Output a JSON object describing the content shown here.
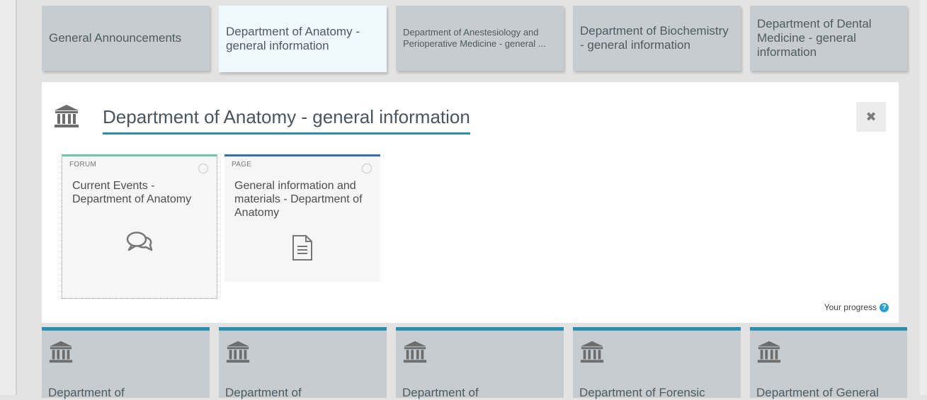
{
  "tabs": [
    {
      "label": "General Announcements"
    },
    {
      "label": "Department of Anatomy - general information"
    },
    {
      "label": "Department of Anestesiology and Perioperative Medicine - general ..."
    },
    {
      "label": "Department of Biochemistry - general information"
    },
    {
      "label": "Department of Dental Medicine - general information"
    }
  ],
  "section": {
    "title": "Department of Anatomy - general information",
    "close_label": "✖",
    "icon": "institution-icon"
  },
  "activities": [
    {
      "type": "FORUM",
      "title": "Current Events - Department of Anatomy",
      "icon": "forum-chat-icon"
    },
    {
      "type": "PAGE",
      "title": "General information and materials - Department of Anatomy",
      "icon": "page-document-icon"
    }
  ],
  "progress": {
    "label": "Your progress",
    "help": "?"
  },
  "bottom_tiles": [
    {
      "label": "Department of"
    },
    {
      "label": "Department of"
    },
    {
      "label": "Department of"
    },
    {
      "label": "Department of Forensic"
    },
    {
      "label": "Department of General"
    }
  ],
  "colors": {
    "accent": "#2a8fb0",
    "forum": "#72c4a8",
    "page": "#3a6fa8",
    "tab_bg": "#c6ccd0",
    "tab_active_bg": "#eef8fd"
  }
}
